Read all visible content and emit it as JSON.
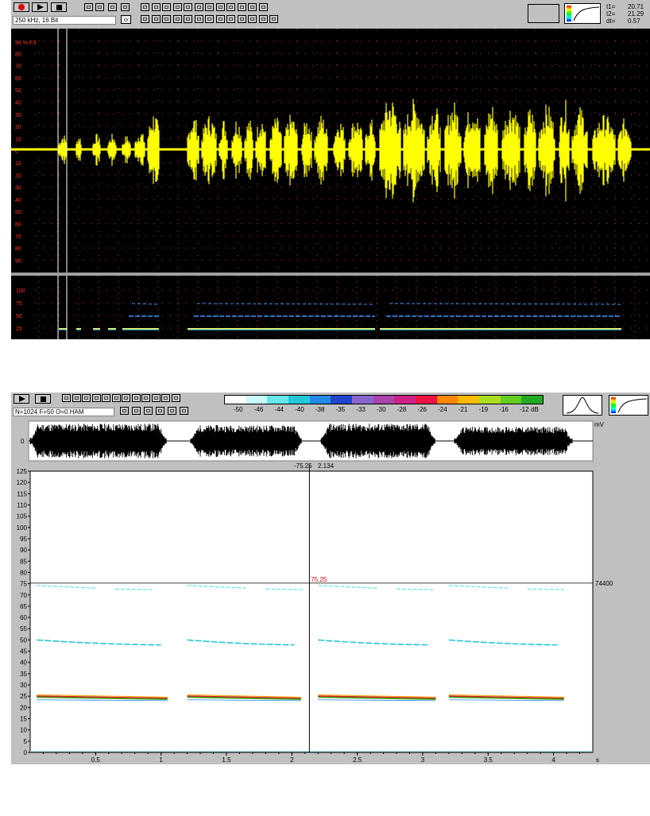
{
  "top": {
    "format_label": "250 kHz, 16 Bit",
    "readout": [
      {
        "label": "t1=",
        "value": "20.71"
      },
      {
        "label": "t2=",
        "value": "21.29"
      },
      {
        "label": "dt=",
        "value": "0.57"
      }
    ],
    "wave_scale_label": "90 % FS",
    "wave_scale_ticks": [
      "80",
      "70",
      "60",
      "50",
      "40",
      "30",
      "20",
      "10",
      "0",
      "10",
      "20",
      "30",
      "40",
      "50",
      "60",
      "70",
      "80",
      "90"
    ],
    "spec_ticks": [
      "100",
      "75",
      "50",
      "25"
    ],
    "colors": {
      "background": "#000000",
      "waveform": "#ffff00",
      "grid": "#cc3333",
      "scale_text": "#ff3333"
    }
  },
  "bottom": {
    "format_label": "N=1024 F=50 O=0 HAM",
    "colorscale": {
      "labels": [
        "-50",
        "-46",
        "-44",
        "-40",
        "-38",
        "-35",
        "-33",
        "-30",
        "-28",
        "-26",
        "-24",
        "-21",
        "-19",
        "-16",
        "-12"
      ],
      "unit": "dB",
      "colors": [
        "#ffffff",
        "#c8f8f8",
        "#66e8e8",
        "#22c8d8",
        "#2288e8",
        "#2244cc",
        "#8866cc",
        "#aa44aa",
        "#cc2288",
        "#ee1144",
        "#ff8800",
        "#ffbb00",
        "#aadd22",
        "#66cc22",
        "#22aa22"
      ]
    },
    "osc_unit": "mV",
    "osc_zero": "0",
    "cursor_left_label": "-75.25",
    "cursor_right_label": "2.134",
    "cursor_freq_label": "75.25",
    "cursor_value_right": "74400",
    "y_ticks": [
      "125",
      "120",
      "115",
      "110",
      "105",
      "100",
      "95",
      "90",
      "85",
      "80",
      "75",
      "70",
      "65",
      "60",
      "55",
      "50",
      "45",
      "40",
      "35",
      "30",
      "25",
      "20",
      "15",
      "10",
      "5",
      "0"
    ],
    "x_ticks": [
      "0.5",
      "1",
      "1.5",
      "2",
      "2.5",
      "3",
      "3.5",
      "4"
    ],
    "x_unit": "s"
  }
}
